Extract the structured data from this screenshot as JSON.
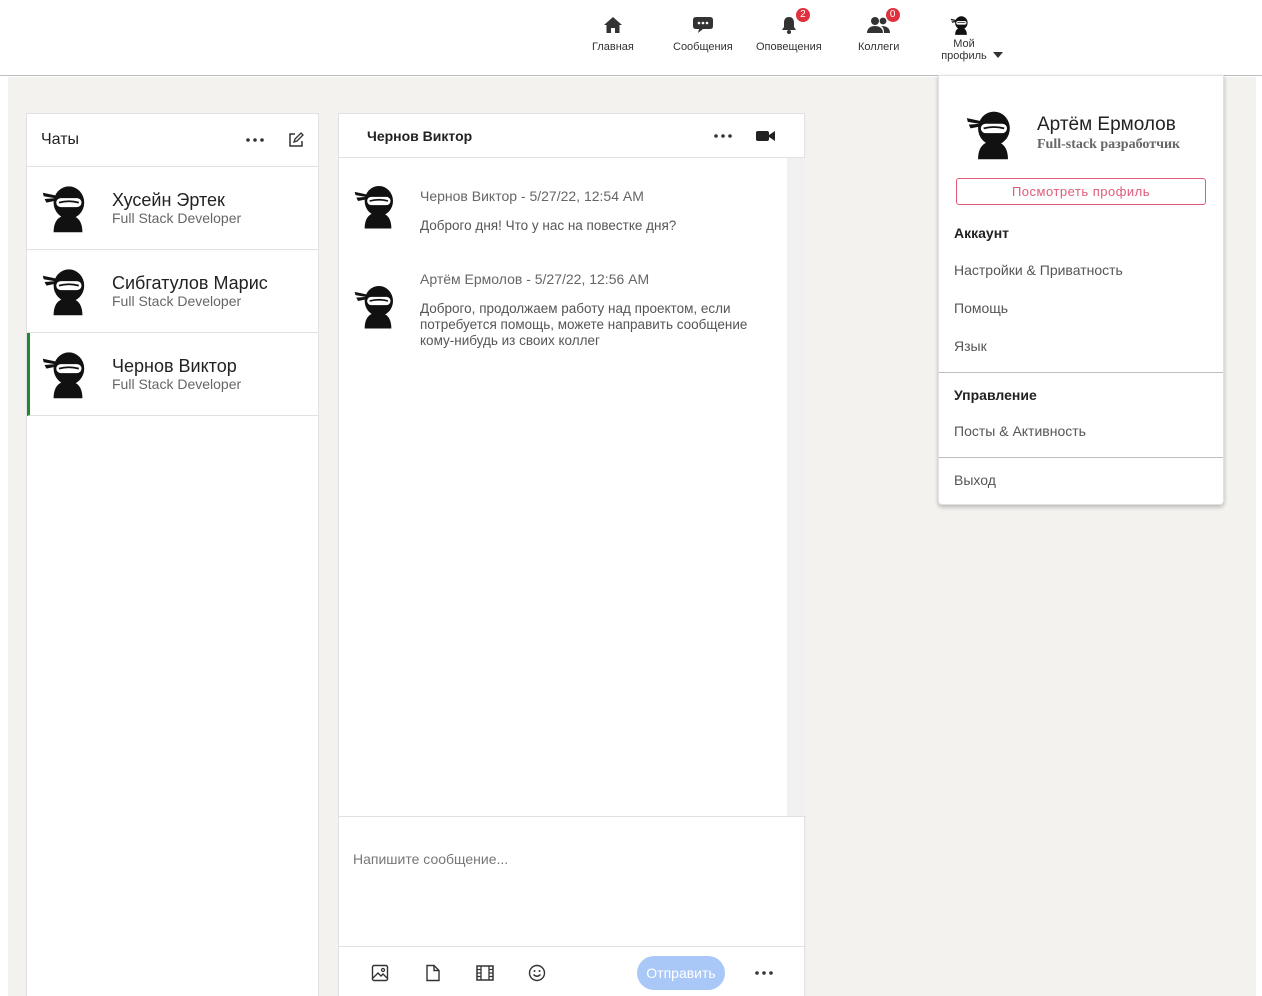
{
  "nav": {
    "home": "Главная",
    "messages": "Сообщения",
    "notifications": "Оповещения",
    "notifications_badge": "2",
    "colleagues": "Коллеги",
    "colleagues_badge": "0",
    "profile_line1": "Мой",
    "profile_line2": "профиль"
  },
  "chats": {
    "title": "Чаты",
    "items": [
      {
        "name": "Хусейн Эртек",
        "role": "Full Stack Developer"
      },
      {
        "name": "Сибгатулов Марис",
        "role": "Full Stack Developer"
      },
      {
        "name": "Чернов Виктор",
        "role": "Full Stack Developer"
      }
    ]
  },
  "conversation": {
    "title": "Чернов Виктор",
    "messages": [
      {
        "author": "Чернов Виктор - 5/27/22, 12:54 AM",
        "text": "Доброго дня! Что у нас на повестке дня?"
      },
      {
        "author": "Артём Ермолов - 5/27/22, 12:56 AM",
        "text": "Доброго, продолжаем работу над проектом, если потребуется помощь, можете направить сообщение кому-нибудь из своих коллег"
      }
    ],
    "composer_placeholder": "Напишите сообщение...",
    "send_label": "Отправить"
  },
  "profile_menu": {
    "name": "Артём Ермолов",
    "title": "Full-stack разработчик",
    "view_profile": "Посмотреть профиль",
    "account_header": "Аккаунт",
    "settings": "Настройки & Приватность",
    "help": "Помощь",
    "language": "Язык",
    "manage_header": "Управление",
    "posts": "Посты & Активность",
    "logout": "Выход"
  },
  "colors": {
    "active_chat_border": "#1f8a2f",
    "badge": "#e0313f",
    "send_button": "#a9c8f7",
    "view_profile_accent": "#e05b7a",
    "background": "#f3f2ef"
  }
}
